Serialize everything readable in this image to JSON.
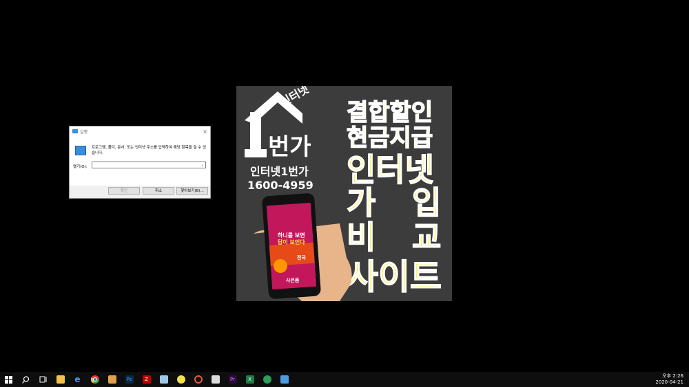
{
  "run_dialog": {
    "title": "실행",
    "close_glyph": "×",
    "description": "프로그램, 폴더, 문서, 또는 인터넷 주소를 입력하여 해당 항목을 열 수 있습니다.",
    "open_label": "열기(O):",
    "open_value": "",
    "ok_label": "확인",
    "cancel_label": "취소",
    "browse_label": "찾아보기(B)..."
  },
  "ad": {
    "logo_small": "인터넷",
    "logo_big": "번가",
    "logo_digit": "1",
    "brand": "인터넷1번가",
    "phone": "1600-4959",
    "line1": "결합할인",
    "line2": "현금지급",
    "line3": "인터넷",
    "line4a": "가",
    "line4b": "입",
    "line5a": "비",
    "line5b": "교",
    "line6": "사이트",
    "phone_screen_text1": "하니를 보면",
    "phone_screen_text2": "답이 보인다",
    "phone_screen_text3": "전국",
    "phone_screen_text4": "사은품"
  },
  "taskbar": {
    "icons": [
      "windows-start",
      "search",
      "task-view",
      "file-explorer",
      "edge",
      "chrome",
      "people",
      "photoshop",
      "filezilla",
      "notepad",
      "app-yellow",
      "app-circle",
      "photos",
      "premiere",
      "excel",
      "maps",
      "monitor"
    ],
    "time": "오후 2:26",
    "date": "2020-04-21"
  },
  "colors": {
    "desktop": "#000000",
    "ad_bg": "#3c3c3c",
    "ad_yellow": "#f2f21a",
    "taskbar": "#0e0e0e"
  }
}
